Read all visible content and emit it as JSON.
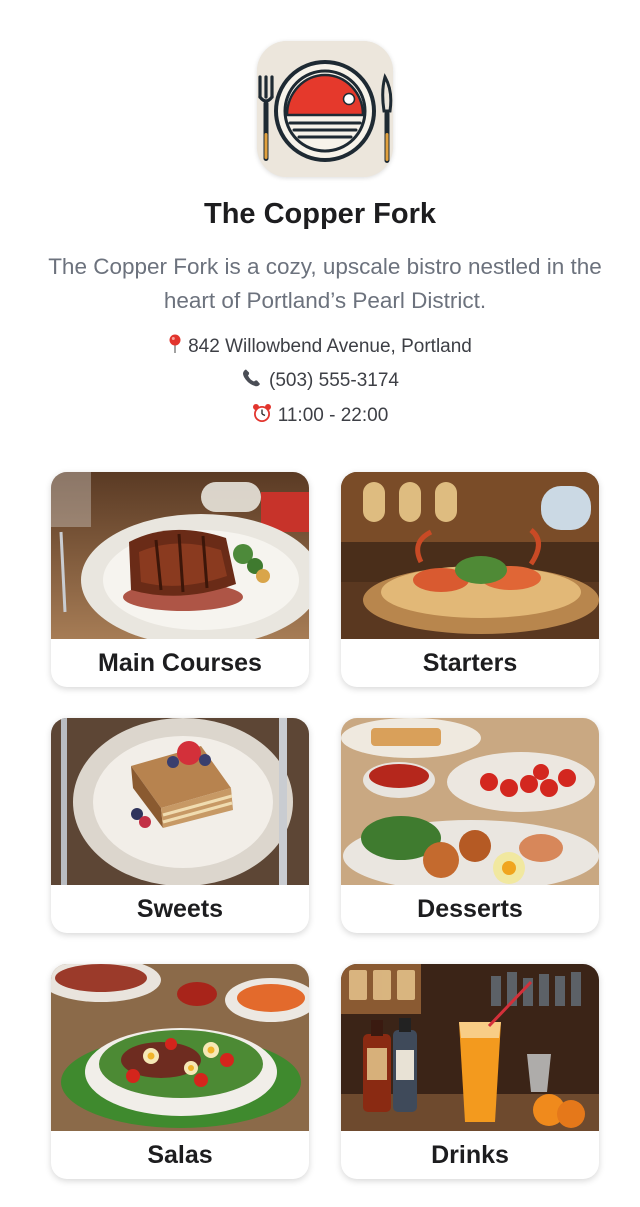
{
  "restaurant": {
    "name": "The Copper Fork",
    "description": "The Copper Fork is a cozy, upscale bistro nestled in the heart of Portland’s Pearl District.",
    "address": "842 Willowbend Avenue, Portland",
    "phone": "(503) 555-3174",
    "hours": "11:00 - 22:00",
    "logo_icon": "plate-fork-knife-icon",
    "icons": {
      "address": "map-pin-icon",
      "phone": "phone-icon",
      "hours": "alarm-clock-icon"
    },
    "colors": {
      "logo_red": "#e5392c",
      "logo_background": "#ece6dc",
      "text_primary": "#1d1d1f",
      "text_secondary": "#6c727d"
    }
  },
  "categories": [
    {
      "label": "Main Courses",
      "image": "steak-plate"
    },
    {
      "label": "Starters",
      "image": "shrimp-plate"
    },
    {
      "label": "Sweets",
      "image": "cake-slice"
    },
    {
      "label": "Desserts",
      "image": "tapas-platter"
    },
    {
      "label": "Salas",
      "image": "salad-bowl"
    },
    {
      "label": "Drinks",
      "image": "cocktail-bar"
    }
  ]
}
